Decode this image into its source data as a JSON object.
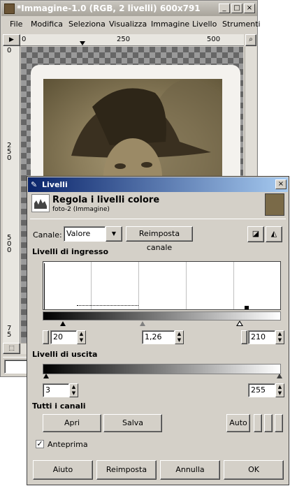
{
  "main_window": {
    "title": "*Immagine-1.0 (RGB, 2 livelli) 600x791",
    "menu": [
      "File",
      "Modifica",
      "Seleziona",
      "Visualizza",
      "Immagine",
      "Livello",
      "Strumenti"
    ],
    "ruler_h_ticks": [
      "0",
      "250",
      "500"
    ],
    "ruler_v_ticks": [
      "0",
      "2\n5\n0",
      "5\n0\n0",
      "7\n5"
    ],
    "nav_icon": "magnifier-icon",
    "corner_icon": "move-icon"
  },
  "dialog": {
    "title": "Livelli",
    "header_title": "Regola i livelli colore",
    "header_subtitle": "foto-2 (Immagine)",
    "channel_label": "Canale:",
    "channel_value": "Valore",
    "reset_channel_button": "Reimposta canale",
    "input_levels_label": "Livelli di ingresso",
    "input_low": "20",
    "input_gamma": "1,26",
    "input_high": "210",
    "output_levels_label": "Livelli di uscita",
    "output_low": "3",
    "output_high": "255",
    "all_channels_label": "Tutti i canali",
    "open_button": "Apri",
    "save_button": "Salva",
    "auto_button": "Auto",
    "preview_label": "Anteprima",
    "preview_checked": true,
    "help_button": "Aiuto",
    "reset_button": "Reimposta",
    "cancel_button": "Annulla",
    "ok_button": "OK"
  }
}
